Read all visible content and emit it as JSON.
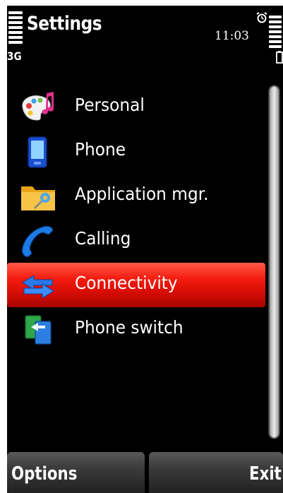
{
  "status_bar": {
    "app_title": "Settings",
    "time": "11:03",
    "network_type": "3G",
    "signal_icon": "signal-strength-icon",
    "battery_icon": "battery-level-icon",
    "alarm_icon": "alarm-clock-icon"
  },
  "settings_list": {
    "items": [
      {
        "label": "Personal",
        "icon": "palette-icon",
        "selected": false
      },
      {
        "label": "Phone",
        "icon": "mobile-phone-icon",
        "selected": false
      },
      {
        "label": "Application mgr.",
        "icon": "folder-wrench-icon",
        "selected": false
      },
      {
        "label": "Calling",
        "icon": "handset-icon",
        "selected": false
      },
      {
        "label": "Connectivity",
        "icon": "transfer-arrows-icon",
        "selected": true
      },
      {
        "label": "Phone switch",
        "icon": "phone-switch-icon",
        "selected": false
      }
    ]
  },
  "softkeys": {
    "left": "Options",
    "right": "Exit"
  },
  "colors": {
    "background": "#000000",
    "selection": "#e8140a",
    "text": "#ffffff"
  }
}
